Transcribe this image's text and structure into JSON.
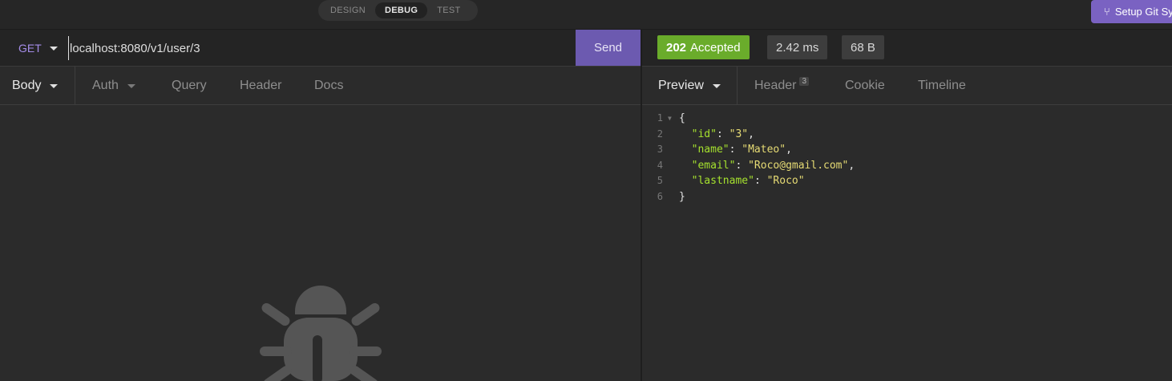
{
  "modes": {
    "design": "DESIGN",
    "debug": "DEBUG",
    "test": "TEST"
  },
  "git_button": {
    "icon": "git-branch-icon",
    "label": "Setup Git Sy"
  },
  "request": {
    "method": "GET",
    "url": "localhost:8080/v1/user/3",
    "send_label": "Send"
  },
  "response_meta": {
    "status_code": "202",
    "status_text": "Accepted",
    "time": "2.42 ms",
    "size": "68 B"
  },
  "request_tabs": {
    "body": "Body",
    "auth": "Auth",
    "query": "Query",
    "header": "Header",
    "docs": "Docs"
  },
  "response_tabs": {
    "preview": "Preview",
    "header": "Header",
    "header_count": "3",
    "cookie": "Cookie",
    "timeline": "Timeline"
  },
  "response_body": {
    "line_numbers": [
      "1",
      "2",
      "3",
      "4",
      "5",
      "6"
    ],
    "open_brace": "{",
    "close_brace": "}",
    "fields": [
      {
        "key": "\"id\"",
        "value": "\"3\"",
        "sep": ","
      },
      {
        "key": "\"name\"",
        "value": "\"Mateo\"",
        "sep": ","
      },
      {
        "key": "\"email\"",
        "value": "\"Roco@gmail.com\"",
        "sep": ","
      },
      {
        "key": "\"lastname\"",
        "value": "\"Roco\"",
        "sep": ""
      }
    ]
  },
  "empty_state_icon": "bug-icon",
  "colors": {
    "accent": "#7a62c2",
    "send": "#6c5ab0",
    "status_ok": "#6aac2b",
    "method": "#a48ce8"
  }
}
